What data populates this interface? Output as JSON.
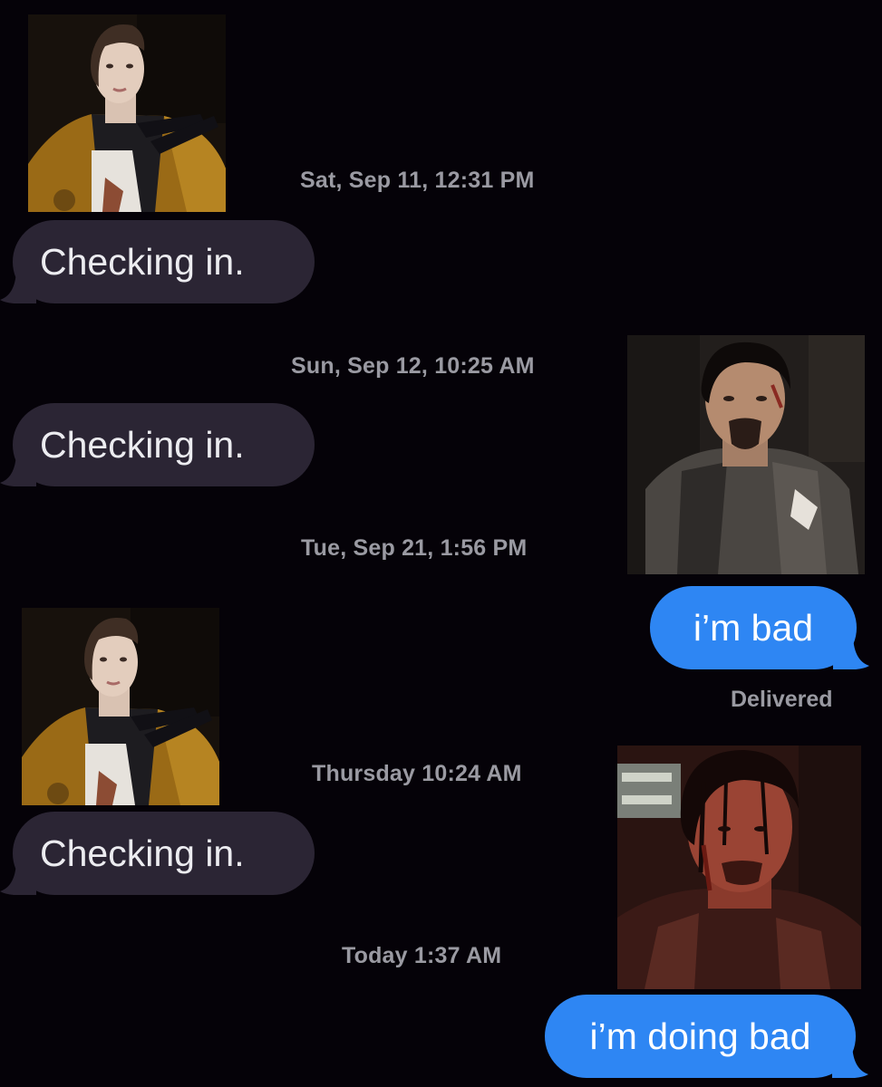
{
  "thread": {
    "timestamps": {
      "t1": "Sat, Sep 11, 12:31 PM",
      "t2": "Sun, Sep 12, 10:25 AM",
      "t3": "Tue, Sep 21, 1:56 PM",
      "t4": "Thursday 10:24 AM",
      "t5": "Today 1:37 AM"
    },
    "messages": {
      "m1": "Checking in.",
      "m2": "Checking in.",
      "m3": "i’m bad",
      "m4": "Checking in.",
      "m5": "i’m doing bad"
    },
    "delivered_status": "Delivered"
  },
  "colors": {
    "background": "#050208",
    "incoming_bubble": "#2b2534",
    "outgoing_bubble": "#2e86f3",
    "timestamp_text": "#9a9aa2"
  }
}
